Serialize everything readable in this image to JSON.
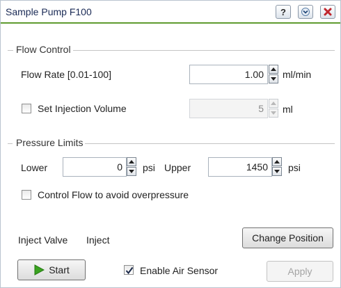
{
  "window": {
    "title": "Sample Pump F100",
    "buttons": {
      "help": "help-icon",
      "collapse": "chevron-down-icon",
      "close": "close-icon"
    }
  },
  "flow_control": {
    "heading": "Flow Control",
    "flow_rate_label": "Flow Rate [0.01-100]",
    "flow_rate_value": "1.00",
    "flow_rate_unit": "ml/min",
    "injection_label": "Set Injection Volume",
    "injection_checked": false,
    "injection_value": "5",
    "injection_unit": "ml"
  },
  "pressure_limits": {
    "heading": "Pressure Limits",
    "lower_label": "Lower",
    "lower_value": "0",
    "lower_unit": "psi",
    "upper_label": "Upper",
    "upper_value": "1450",
    "upper_unit": "psi",
    "control_flow_label": "Control Flow to avoid overpressure",
    "control_flow_checked": false
  },
  "valve": {
    "label": "Inject Valve",
    "position": "Inject",
    "change_button": "Change Position"
  },
  "footer": {
    "start_button": "Start",
    "air_sensor_label": "Enable Air Sensor",
    "air_sensor_checked": true,
    "apply_button": "Apply"
  },
  "colors": {
    "title_underline": "#5f9b2f",
    "close_icon": "#c0262d",
    "start_icon": "#3aa320"
  }
}
